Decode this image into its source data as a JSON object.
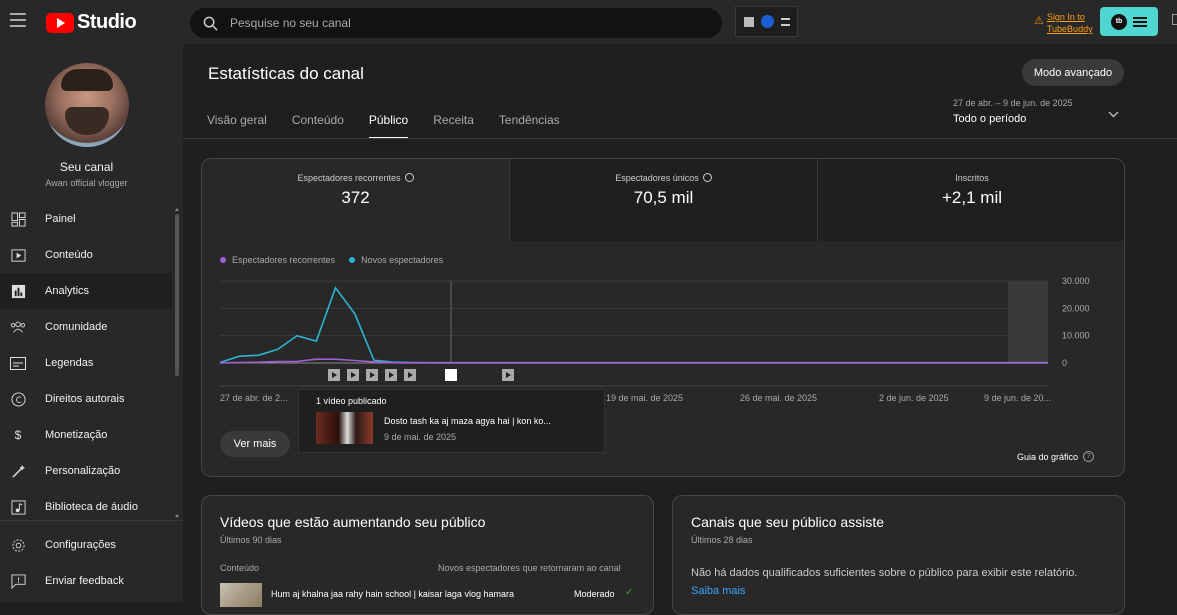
{
  "header": {
    "app_name": "Studio",
    "search_placeholder": "Pesquise no seu canal",
    "signin_label": "Sign In to TubeBuddy",
    "tubebuddy_label": "tb"
  },
  "sidebar": {
    "channel_name": "Seu canal",
    "channel_handle": "Awan official vlogger",
    "items": [
      {
        "label": "Painel",
        "icon": "dashboard-icon"
      },
      {
        "label": "Conteúdo",
        "icon": "content-icon"
      },
      {
        "label": "Analytics",
        "icon": "analytics-icon"
      },
      {
        "label": "Comunidade",
        "icon": "community-icon"
      },
      {
        "label": "Legendas",
        "icon": "subtitles-icon"
      },
      {
        "label": "Direitos autorais",
        "icon": "copyright-icon"
      },
      {
        "label": "Monetização",
        "icon": "monetization-icon"
      },
      {
        "label": "Personalização",
        "icon": "customization-icon"
      },
      {
        "label": "Biblioteca de áudio",
        "icon": "audio-library-icon"
      }
    ],
    "bottom_items": [
      {
        "label": "Configurações",
        "icon": "gear-icon"
      },
      {
        "label": "Enviar feedback",
        "icon": "feedback-icon"
      }
    ]
  },
  "main": {
    "title": "Estatísticas do canal",
    "advanced_button": "Modo avançado",
    "tabs": [
      "Visão geral",
      "Conteúdo",
      "Público",
      "Receita",
      "Tendências"
    ],
    "active_tab": "Público",
    "period_range": "27 de abr. – 9 de jun. de 2025",
    "period_label": "Todo o período",
    "stats": [
      {
        "label": "Espectadores recorrentes",
        "value": "372"
      },
      {
        "label": "Espectadores únicos",
        "value": "70,5 mil"
      },
      {
        "label": "Inscritos",
        "value": "+2,1 mil"
      }
    ],
    "legend": [
      {
        "label": "Espectadores recorrentes",
        "color": "#a15fd6"
      },
      {
        "label": "Novos espectadores",
        "color": "#2fb3d4"
      }
    ],
    "see_more": "Ver mais",
    "popup": {
      "title": "1 vídeo publicado",
      "video_title": "Dosto tash ka aj maza agya hai | kon ko...",
      "video_date": "9 de mai. de 2025"
    },
    "chart_guide": "Guia do gráfico",
    "growing_card": {
      "title": "Vídeos que estão aumentando seu público",
      "subtitle": "Últimos 90 dias",
      "col_content": "Conteúdo",
      "col_metric": "Novos espectadores que retornaram ao canal",
      "row_title": "Hum aj khalna jaa rahy hain school | kaisar laga vlog hamara",
      "row_status": "Moderado"
    },
    "channels_card": {
      "title": "Canais que seu público assiste",
      "subtitle": "Últimos 28 dias",
      "message": "Não há dados qualificados suficientes sobre o público para exibir este relatório.",
      "link": "Saiba mais"
    }
  },
  "chart_data": {
    "type": "line",
    "x_tick_labels": [
      "27 de abr. de 2...",
      "19 de mai. de 2025",
      "26 de mai. de 2025",
      "2 de jun. de 2025",
      "9 de jun. de 20..."
    ],
    "y_tick_labels": [
      "30.000",
      "20.000",
      "10.000",
      "0"
    ],
    "ylim": [
      0,
      30000
    ],
    "x": [
      0,
      1,
      2,
      3,
      4,
      5,
      6,
      7,
      8,
      9,
      10,
      11,
      12,
      13,
      14,
      15,
      16,
      17,
      18,
      19,
      20,
      21,
      22,
      23,
      24,
      25,
      26,
      27,
      28,
      29,
      30,
      31,
      32,
      33,
      34,
      35,
      36,
      37,
      38,
      39,
      40,
      41,
      42,
      43
    ],
    "series": [
      {
        "name": "Novos espectadores",
        "color": "#2fb3d4",
        "values": [
          200,
          2500,
          2800,
          5000,
          10000,
          8000,
          27500,
          18000,
          1000,
          300,
          200,
          100,
          100,
          100,
          100,
          100,
          100,
          100,
          100,
          100,
          100,
          100,
          100,
          100,
          100,
          100,
          100,
          100,
          100,
          100,
          100,
          100,
          100,
          100,
          100,
          100,
          100,
          100,
          100,
          100,
          100,
          100,
          100,
          100
        ]
      },
      {
        "name": "Espectadores recorrentes",
        "color": "#a15fd6",
        "values": [
          50,
          200,
          300,
          500,
          600,
          1400,
          1400,
          900,
          400,
          100,
          50,
          30,
          30,
          30,
          30,
          30,
          30,
          30,
          30,
          30,
          30,
          30,
          30,
          30,
          30,
          30,
          30,
          30,
          30,
          30,
          30,
          30,
          30,
          30,
          30,
          30,
          30,
          30,
          30,
          30,
          30,
          30,
          30,
          30
        ]
      }
    ],
    "upload_markers": 6
  }
}
